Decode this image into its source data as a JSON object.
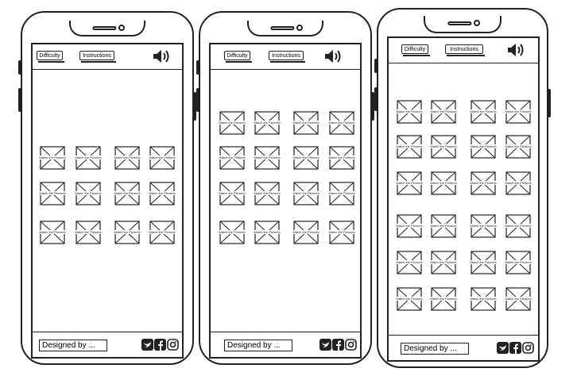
{
  "phones": [
    {
      "difficulty_label": "Difficulty",
      "instructions_label": "Instructions",
      "tile_caption": "Match the Pictures",
      "footer_text": "Designed by ..."
    },
    {
      "difficulty_label": "Difficulty",
      "instructions_label": "Instructions",
      "tile_caption": "Match the Pictures",
      "footer_text": "Designed by ..."
    },
    {
      "difficulty_label": "Difficulty",
      "instructions_label": "Instructions",
      "tile_caption": "Match the Pictures",
      "footer_text": "Designed by ..."
    }
  ],
  "icons": {
    "sound": "speaker-volume-icon",
    "social": [
      "twitter-icon",
      "facebook-icon",
      "instagram-icon"
    ]
  }
}
